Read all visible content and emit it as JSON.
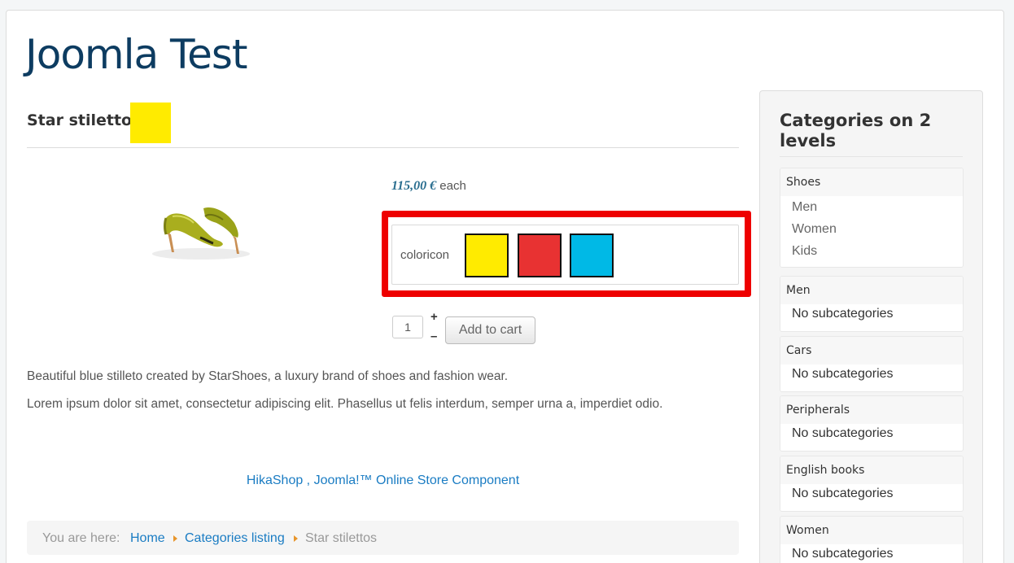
{
  "site": {
    "title": "Joomla Test"
  },
  "product": {
    "title": "Star stilettos:",
    "title_swatch_color": "#ffeb00",
    "price": "115,00 €",
    "price_unit": "each",
    "option_label": "coloricon",
    "option_swatches": [
      {
        "name": "yellow",
        "color": "#ffeb00"
      },
      {
        "name": "red",
        "color": "#e83232"
      },
      {
        "name": "blue",
        "color": "#00b9e6"
      }
    ],
    "quantity": "1",
    "qty_plus": "+",
    "qty_minus": "–",
    "add_to_cart": "Add to cart",
    "description": [
      "Beautiful blue stilleto created by StarShoes, a luxury brand of shoes and fashion wear.",
      "Lorem ipsum dolor sit amet, consectetur adipiscing elit. Phasellus ut felis interdum, semper urna a, imperdiet odio."
    ],
    "highlight_color": "#ee0000"
  },
  "footer": {
    "link": "HikaShop , Joomla!™ Online Store Component"
  },
  "breadcrumb": {
    "prefix": "You are here:",
    "items": [
      "Home",
      "Categories listing",
      "Star stilettos"
    ]
  },
  "sidebar": {
    "title": "Categories on 2 levels",
    "categories": [
      {
        "name": "Shoes",
        "subs": [
          "Men",
          "Women",
          "Kids"
        ]
      },
      {
        "name": "Men",
        "empty": "No subcategories"
      },
      {
        "name": "Cars",
        "empty": "No subcategories"
      },
      {
        "name": "Peripherals",
        "empty": "No subcategories"
      },
      {
        "name": "English books",
        "empty": "No subcategories"
      },
      {
        "name": "Women",
        "empty": "No subcategories"
      }
    ]
  },
  "colors": {
    "title": "#0d3c61",
    "link": "#1a7cc3",
    "price": "#2a6e8f",
    "breadcrumb_arrow": "#e8952a"
  }
}
